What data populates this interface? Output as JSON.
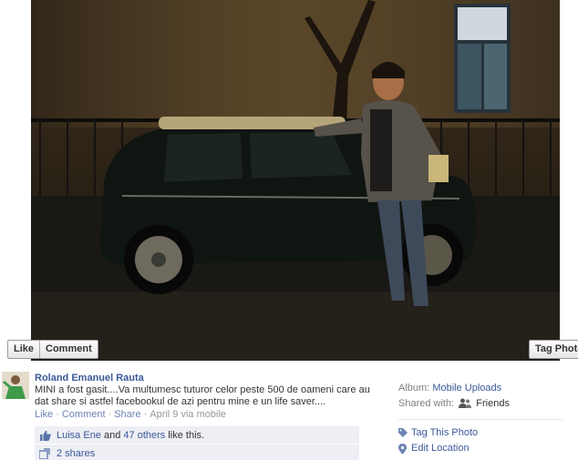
{
  "photo_actions": {
    "like_label": "Like",
    "comment_label": "Comment",
    "tag_label": "Tag Photo"
  },
  "post": {
    "author": "Roland Emanuel Rauta",
    "caption": "MINI a fost gasit....Va multumesc tuturor celor peste 500 de oameni care au dat share si astfel facebookul de azi pentru mine e un life saver....",
    "meta": {
      "like": "Like",
      "comment": "Comment",
      "share": "Share",
      "date": "April 9 via mobile"
    },
    "likes": {
      "name": "Luisa Ene",
      "and": "and",
      "others": "47 others",
      "suffix": "like this."
    },
    "shares": "2 shares"
  },
  "sidebar": {
    "album_label": "Album:",
    "album_value": "Mobile Uploads",
    "shared_label": "Shared with:",
    "shared_value": "Friends",
    "tag_this_photo": "Tag This Photo",
    "edit_location": "Edit Location"
  },
  "icons": {
    "like": "thumbs-up-icon",
    "share": "share-icon",
    "friends": "friends-icon",
    "tag": "tag-icon",
    "location": "location-pin-icon"
  },
  "colors": {
    "link": "#3b5998",
    "ufi_bg": "#edeff4"
  }
}
